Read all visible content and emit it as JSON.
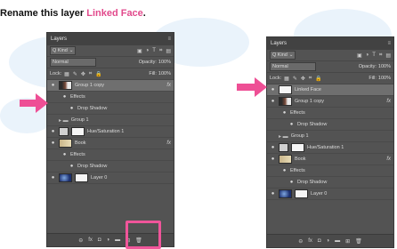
{
  "caption": {
    "prefix": "Rename",
    "middle": " this layer ",
    "highlight": "Linked Face",
    "suffix": "."
  },
  "left_panel": {
    "tab": "Layers",
    "kind": "Q Kind",
    "mode": "Normal",
    "opacity_label": "Opacity:",
    "opacity_value": "100%",
    "lock_label": "Lock:",
    "fill_label": "Fill:",
    "fill_value": "100%",
    "layers": [
      {
        "name": "Group 1 copy",
        "fx": "fx",
        "selected": true
      },
      {
        "name": "Effects"
      },
      {
        "name": "Drop Shadow"
      },
      {
        "name": "Group 1"
      },
      {
        "name": "Hue/Saturation 1"
      },
      {
        "name": "Book",
        "fx": "fx"
      },
      {
        "name": "Effects"
      },
      {
        "name": "Drop Shadow"
      },
      {
        "name": "Layer 0"
      }
    ]
  },
  "right_panel": {
    "tab": "Layers",
    "kind": "Q Kind",
    "mode": "Normal",
    "opacity_label": "Opacity:",
    "opacity_value": "100%",
    "lock_label": "Lock:",
    "fill_label": "Fill:",
    "fill_value": "100%",
    "layers": [
      {
        "name": "Linked Face",
        "selected": true
      },
      {
        "name": "Group 1 copy",
        "fx": "fx"
      },
      {
        "name": "Effects"
      },
      {
        "name": "Drop Shadow"
      },
      {
        "name": "Group 1"
      },
      {
        "name": "Hue/Saturation 1"
      },
      {
        "name": "Book",
        "fx": "fx"
      },
      {
        "name": "Effects"
      },
      {
        "name": "Drop Shadow"
      },
      {
        "name": "Layer 0"
      }
    ]
  },
  "colors": {
    "accent": "#e24a8c",
    "panel_bg": "#535353",
    "selected_row": "#6f6f6f"
  }
}
